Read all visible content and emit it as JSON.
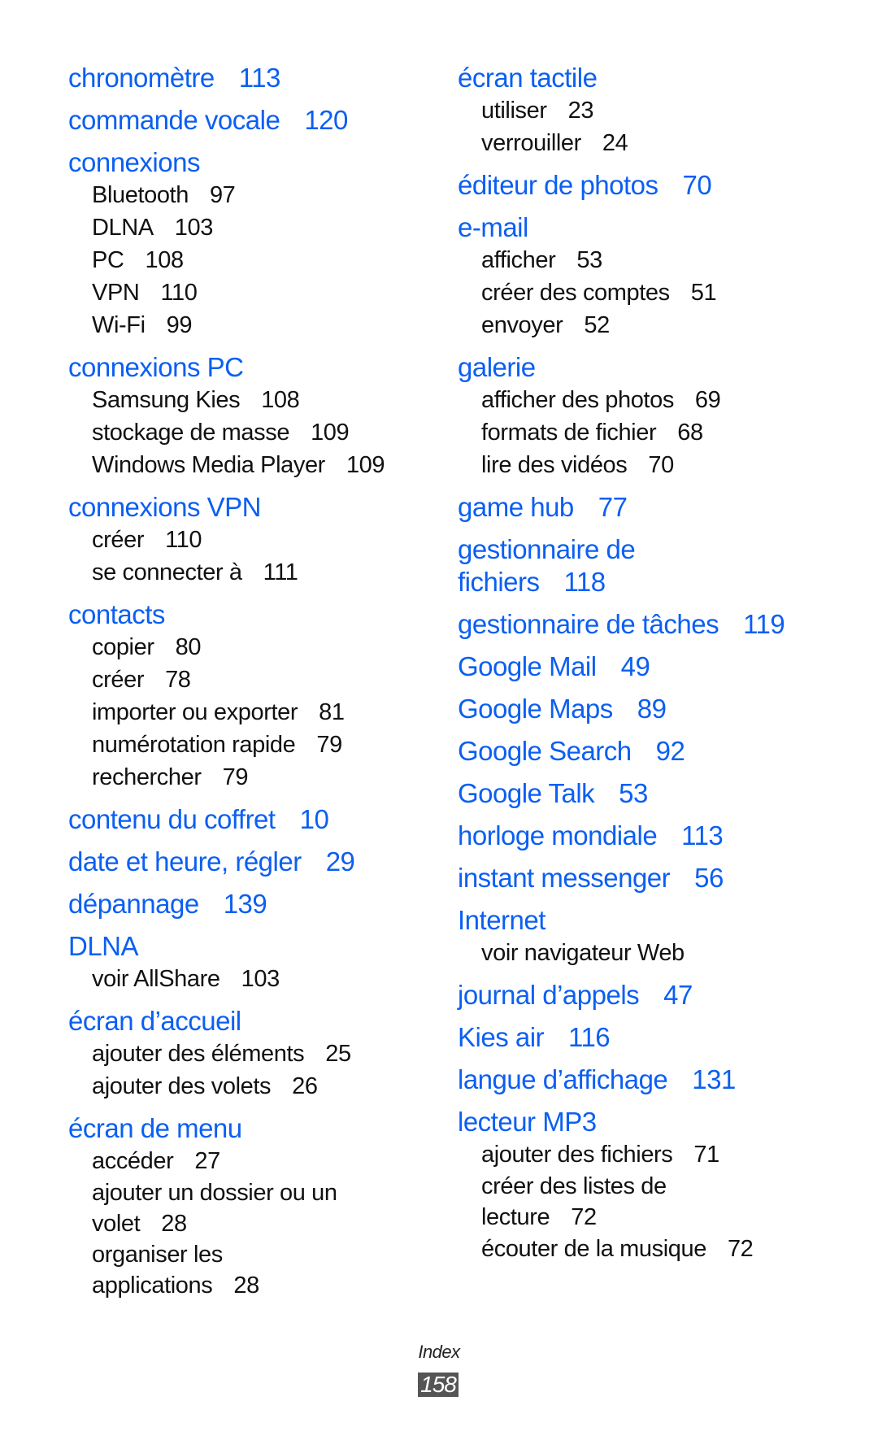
{
  "left_column": [
    {
      "term": "chronomètre",
      "page": "113",
      "subs": []
    },
    {
      "term": "commande vocale",
      "page": "120",
      "subs": []
    },
    {
      "term": "connexions",
      "page": "",
      "subs": [
        {
          "text": "Bluetooth",
          "page": "97"
        },
        {
          "text": "DLNA",
          "page": "103"
        },
        {
          "text": "PC",
          "page": "108"
        },
        {
          "text": "VPN",
          "page": "110"
        },
        {
          "text": "Wi-Fi",
          "page": "99"
        }
      ]
    },
    {
      "term": "connexions PC",
      "page": "",
      "subs": [
        {
          "text": "Samsung Kies",
          "page": "108"
        },
        {
          "text": "stockage de masse",
          "page": "109"
        },
        {
          "text": "Windows Media Player",
          "page": "109"
        }
      ]
    },
    {
      "term": "connexions VPN",
      "page": "",
      "subs": [
        {
          "text": "créer",
          "page": "110"
        },
        {
          "text": "se connecter à",
          "page": "111"
        }
      ]
    },
    {
      "term": "contacts",
      "page": "",
      "subs": [
        {
          "text": "copier",
          "page": "80"
        },
        {
          "text": "créer",
          "page": "78"
        },
        {
          "text": "importer ou exporter",
          "page": "81"
        },
        {
          "text": "numérotation rapide",
          "page": "79"
        },
        {
          "text": "rechercher",
          "page": "79"
        }
      ]
    },
    {
      "term": "contenu du coffret",
      "page": "10",
      "subs": []
    },
    {
      "term": "date et heure, régler",
      "page": "29",
      "subs": []
    },
    {
      "term": "dépannage",
      "page": "139",
      "subs": []
    },
    {
      "term": "DLNA",
      "page": "",
      "subs": [
        {
          "text": "voir AllShare",
          "page": "103"
        }
      ]
    },
    {
      "term": "écran d’accueil",
      "page": "",
      "subs": [
        {
          "text": "ajouter des éléments",
          "page": "25"
        },
        {
          "text": "ajouter des volets",
          "page": "26"
        }
      ]
    },
    {
      "term": "écran de menu",
      "page": "",
      "subs": [
        {
          "text": "accéder",
          "page": "27"
        },
        {
          "text": "ajouter un dossier ou un\nvolet",
          "page": "28"
        },
        {
          "text": "organiser les\napplications",
          "page": "28"
        }
      ]
    }
  ],
  "right_column": [
    {
      "term": "écran tactile",
      "page": "",
      "subs": [
        {
          "text": "utiliser",
          "page": "23"
        },
        {
          "text": "verrouiller",
          "page": "24"
        }
      ]
    },
    {
      "term": "éditeur de photos",
      "page": "70",
      "subs": []
    },
    {
      "term": "e-mail",
      "page": "",
      "subs": [
        {
          "text": "afficher",
          "page": "53"
        },
        {
          "text": "créer des comptes",
          "page": "51"
        },
        {
          "text": "envoyer",
          "page": "52"
        }
      ]
    },
    {
      "term": "galerie",
      "page": "",
      "subs": [
        {
          "text": "afficher des photos",
          "page": "69"
        },
        {
          "text": "formats de fichier",
          "page": "68"
        },
        {
          "text": "lire des vidéos",
          "page": "70"
        }
      ]
    },
    {
      "term": "game hub",
      "page": "77",
      "subs": []
    },
    {
      "term": "gestionnaire de\nfichiers",
      "page": "118",
      "subs": []
    },
    {
      "term": "gestionnaire de tâches",
      "page": "119",
      "subs": []
    },
    {
      "term": "Google Mail",
      "page": "49",
      "subs": []
    },
    {
      "term": "Google Maps",
      "page": "89",
      "subs": []
    },
    {
      "term": "Google Search",
      "page": "92",
      "subs": []
    },
    {
      "term": "Google Talk",
      "page": "53",
      "subs": []
    },
    {
      "term": "horloge mondiale",
      "page": "113",
      "subs": []
    },
    {
      "term": "instant messenger",
      "page": "56",
      "subs": []
    },
    {
      "term": "Internet",
      "page": "",
      "subs": [
        {
          "text": "voir navigateur Web",
          "page": ""
        }
      ]
    },
    {
      "term": "journal d’appels",
      "page": "47",
      "subs": []
    },
    {
      "term": "Kies air",
      "page": "116",
      "subs": []
    },
    {
      "term": "langue d’affichage",
      "page": "131",
      "subs": []
    },
    {
      "term": "lecteur MP3",
      "page": "",
      "subs": [
        {
          "text": "ajouter des fichiers",
          "page": "71"
        },
        {
          "text": "créer des listes de\nlecture",
          "page": "72"
        },
        {
          "text": "écouter de la musique",
          "page": "72"
        }
      ]
    }
  ],
  "footer": {
    "section_label": "Index",
    "page_number": "158"
  },
  "colors": {
    "heading": "#0b5ff2",
    "subentry": "#111111",
    "page_box": "#555555"
  }
}
